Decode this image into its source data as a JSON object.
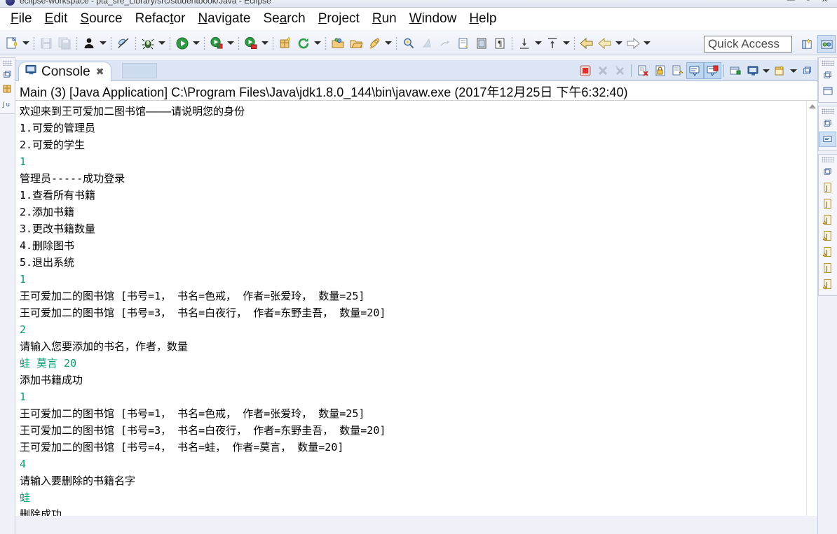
{
  "window": {
    "title": "eclipse-workspace - pta_sre_Library/src/studentbook/Java - Eclipse",
    "buttons": [
      "minimize",
      "maximize",
      "close"
    ]
  },
  "menubar": {
    "items": [
      {
        "label": "File",
        "mnemonic": "F"
      },
      {
        "label": "Edit",
        "mnemonic": "E"
      },
      {
        "label": "Source",
        "mnemonic": "S"
      },
      {
        "label": "Refactor",
        "mnemonic": "t"
      },
      {
        "label": "Navigate",
        "mnemonic": "N"
      },
      {
        "label": "Search",
        "mnemonic": "a"
      },
      {
        "label": "Project",
        "mnemonic": "P"
      },
      {
        "label": "Run",
        "mnemonic": "R"
      },
      {
        "label": "Window",
        "mnemonic": "W"
      },
      {
        "label": "Help",
        "mnemonic": "H"
      }
    ]
  },
  "toolbar": {
    "icons": [
      "new-wizard-icon",
      "save-icon",
      "save-all-icon",
      "person-icon",
      "toggle-breakpoint-icon",
      "debug-icon",
      "run-icon",
      "run-external-tools-icon",
      "coverage-icon",
      "new-java-package-icon",
      "refresh-icon",
      "open-type-icon",
      "open-task-icon",
      "launch-icon",
      "search-icon",
      "previous-annotation-icon",
      "next-annotation-icon",
      "last-edit-location-icon",
      "toggle-block-selection-icon",
      "show-whitespace-icon",
      "next-edit-icon",
      "previous-edit-icon",
      "back-icon",
      "forward-icon",
      "next-icon"
    ]
  },
  "quick_access": {
    "placeholder": "Quick Access",
    "value": "Quick Access"
  },
  "perspective": {
    "buttons": [
      "open-perspective-icon",
      "java-perspective-icon"
    ]
  },
  "left_rail": {
    "items": [
      "restore-icon",
      "package-explorer-icon",
      "junit-icon"
    ]
  },
  "right_rail": {
    "stacks": [
      {
        "items": [
          "restore-icon",
          "outline-icon"
        ]
      },
      {
        "items": [
          "restore-icon",
          "console-icon"
        ]
      },
      {
        "items": [
          "restore-icon",
          "java-file-icon",
          "java-file-icon",
          "java-file-warning-icon",
          "java-file-warning-icon",
          "java-file-warning-icon",
          "java-file-icon",
          "java-file-warning-icon"
        ]
      }
    ]
  },
  "console": {
    "tab": {
      "label": "Console",
      "icon": "console-monitor-icon",
      "close": "✖"
    },
    "tools": [
      "terminate-icon",
      "remove-launch-icon",
      "remove-all-launches-icon",
      "clear-console-icon",
      "scroll-lock-icon",
      "show-console-on-output-icon",
      "pin-console-icon",
      "display-selected-console-icon",
      "open-console-icon",
      "open-console-menu-icon",
      "new-console-view-icon",
      "new-console-menu-icon",
      "minimize-icon"
    ],
    "header": "Main (3) [Java Application] C:\\Program Files\\Java\\jdk1.8.0_144\\bin\\javaw.exe (2017年12月25日 下午6:32:40)",
    "lines": [
      {
        "text": "欢迎来到王可爱加二图书馆————请说明您的身份",
        "type": "output"
      },
      {
        "text": "1.可爱的管理员",
        "type": "output"
      },
      {
        "text": "2.可爱的学生",
        "type": "output"
      },
      {
        "text": "1",
        "type": "input"
      },
      {
        "text": "管理员-----成功登录",
        "type": "output"
      },
      {
        "text": "1.查看所有书籍",
        "type": "output"
      },
      {
        "text": "2.添加书籍",
        "type": "output"
      },
      {
        "text": "3.更改书籍数量",
        "type": "output"
      },
      {
        "text": "4.删除图书",
        "type": "output"
      },
      {
        "text": "5.退出系统",
        "type": "output"
      },
      {
        "text": "1",
        "type": "input"
      },
      {
        "text": "王可爱加二的图书馆 [书号=1， 书名=色戒， 作者=张爱玲， 数量=25]",
        "type": "output"
      },
      {
        "text": "王可爱加二的图书馆 [书号=3， 书名=白夜行， 作者=东野圭吾， 数量=20]",
        "type": "output"
      },
      {
        "text": "2",
        "type": "input"
      },
      {
        "text": "请输入您要添加的书名，作者，数量",
        "type": "output"
      },
      {
        "text": "蛙 莫言 20",
        "type": "input"
      },
      {
        "text": "添加书籍成功",
        "type": "output"
      },
      {
        "text": "1",
        "type": "input"
      },
      {
        "text": "王可爱加二的图书馆 [书号=1， 书名=色戒， 作者=张爱玲， 数量=25]",
        "type": "output"
      },
      {
        "text": "王可爱加二的图书馆 [书号=3， 书名=白夜行， 作者=东野圭吾， 数量=20]",
        "type": "output"
      },
      {
        "text": "王可爱加二的图书馆 [书号=4， 书名=蛙， 作者=莫言， 数量=20]",
        "type": "output"
      },
      {
        "text": "4",
        "type": "input"
      },
      {
        "text": "请输入要删除的书籍名字",
        "type": "output"
      },
      {
        "text": "蛙",
        "type": "input"
      },
      {
        "text": "删除成功",
        "type": "output"
      }
    ]
  },
  "colors": {
    "input_text": "#0a9b78",
    "output_text": "#000000",
    "tab_bar": "#dce6f4",
    "toolbar_bg": "#eef2f9",
    "stop_button": "#e03030"
  }
}
